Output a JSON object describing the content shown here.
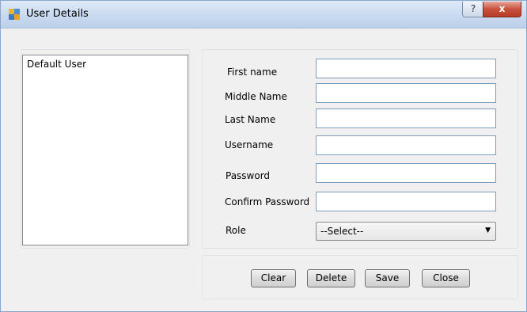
{
  "window": {
    "title": "User Details",
    "help_label": "?",
    "close_label": "x"
  },
  "user_list": {
    "items": [
      "Default User"
    ]
  },
  "form": {
    "first_name_label": "First name",
    "middle_name_label": "Middle Name",
    "last_name_label": "Last Name",
    "username_label": "Username",
    "password_label": "Password",
    "confirm_password_label": "Confirm Password",
    "role_label": "Role",
    "first_name_value": "",
    "middle_name_value": "",
    "last_name_value": "",
    "username_value": "",
    "password_value": "",
    "confirm_password_value": "",
    "role_selected": "--Select--"
  },
  "buttons": {
    "clear": "Clear",
    "delete": "Delete",
    "save": "Save",
    "close": "Close"
  }
}
